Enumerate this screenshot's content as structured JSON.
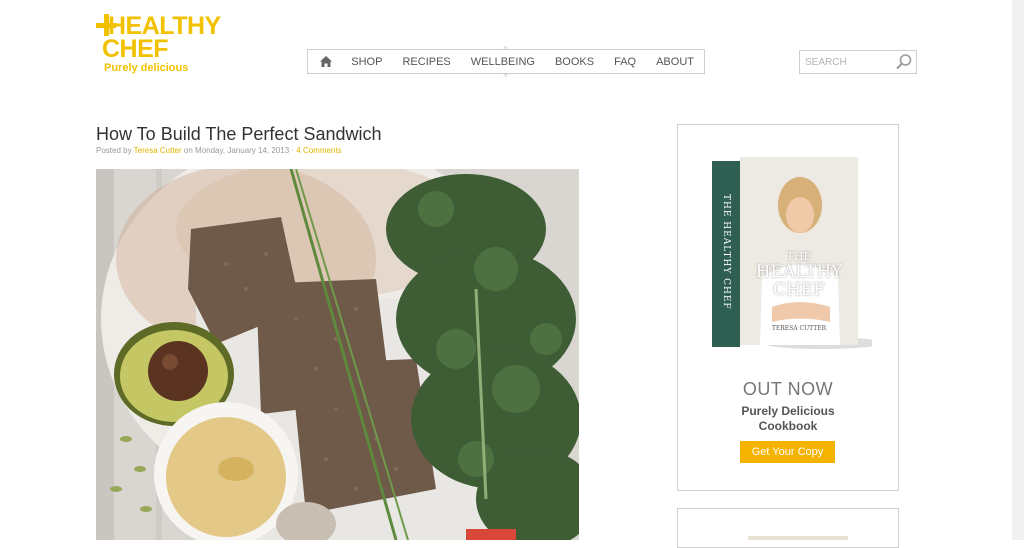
{
  "brand": {
    "logo_line1": "HEALTHY",
    "logo_line2": "CHEF",
    "tagline": "Purely delicious",
    "color": "#f2c200"
  },
  "nav": {
    "home_icon": "home-icon",
    "items": [
      {
        "label": "SHOP"
      },
      {
        "label": "RECIPES"
      },
      {
        "label": "WELLBEING"
      },
      {
        "label": "BOOKS"
      },
      {
        "label": "FAQ"
      },
      {
        "label": "ABOUT"
      }
    ]
  },
  "search": {
    "placeholder": "SEARCH",
    "icon": "search-icon"
  },
  "post": {
    "title": "How To Build The Perfect Sandwich",
    "meta_prefix": "Posted by ",
    "author": "Teresa Cutter",
    "meta_date": " on Monday, January 14, 2013 · ",
    "comments": "4 Comments",
    "image": {
      "description_icon": "sandwich-ingredients-photo",
      "colors": {
        "board": "#e8e6e2",
        "bread": "#6d5848",
        "kale": "#3e5d35",
        "avocado": "#9aa44a",
        "hummus": "#e2c886"
      }
    }
  },
  "sidebar_ad": {
    "book": {
      "spine_text": "THE HEALTHY CHEF",
      "cover_title_line1": "THE",
      "cover_title_line2": "HEALTHY",
      "cover_title_line3": "CHEF",
      "cover_author": "TERESA CUTTER"
    },
    "heading": "OUT NOW",
    "sub_line1": "Purely Delicious",
    "sub_line2": "Cookbook",
    "button_label": "Get Your Copy",
    "button_color": "#f5b300"
  }
}
